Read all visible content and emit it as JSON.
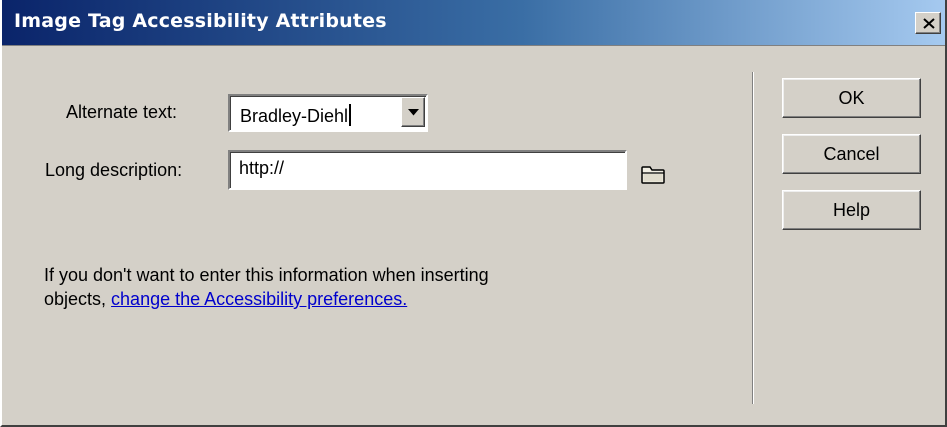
{
  "window": {
    "title": "Image Tag Accessibility Attributes"
  },
  "form": {
    "alt_text_label": "Alternate text:",
    "alt_text_value": "Bradley-Diehl",
    "long_desc_label": "Long description:",
    "long_desc_value": "http://"
  },
  "info": {
    "text_line1": "If you don't want to enter this information when inserting",
    "text_line2_prefix": "objects, ",
    "link_text": "change the Accessibility preferences."
  },
  "buttons": {
    "ok": "OK",
    "cancel": "Cancel",
    "help": "Help"
  },
  "icons": {
    "close": "close-icon",
    "dropdown": "chevron-down-icon",
    "browse": "folder-icon"
  },
  "colors": {
    "title_bar_start": "#0a246a",
    "title_bar_end": "#a6caf0",
    "dialog_bg": "#d4d0c8",
    "link": "#0000cc"
  }
}
